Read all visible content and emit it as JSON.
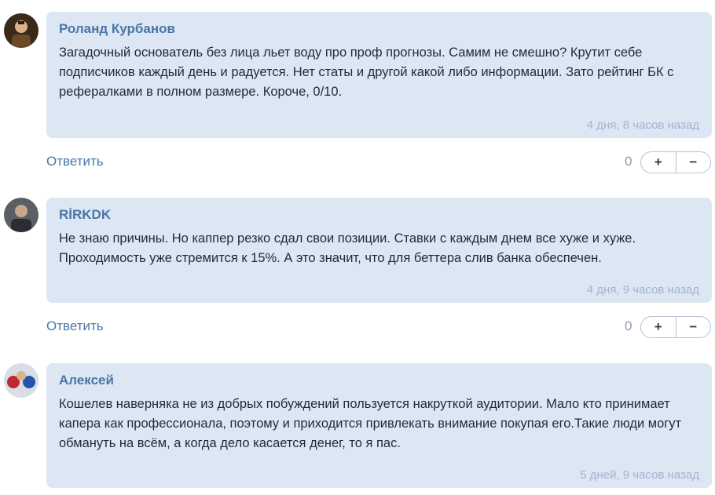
{
  "comments": [
    {
      "author": "Роланд Курбанов",
      "text": "Загадочный основатель без лица льет воду про проф прогнозы. Самим не смешно? Крутит себе подписчиков каждый день и радуется. Нет статы и другой какой либо информации. Зато рейтинг БК с рефералками в полном размере. Короче, 0/10.",
      "time": "4 дня, 8 часов назад",
      "reply_label": "Ответить",
      "score": "0",
      "plus": "+",
      "minus": "−"
    },
    {
      "author": "RİRKDK",
      "text": "Не знаю причины. Но каппер резко сдал свои позиции. Ставки с каждым днем все хуже и хуже. Проходимость уже стремится к 15%. А это значит, что для беттера слив банка обеспечен.",
      "time": "4 дня, 9 часов назад",
      "reply_label": "Ответить",
      "score": "0",
      "plus": "+",
      "minus": "−"
    },
    {
      "author": "Алексей",
      "text": "Кошелев наверняка не из добрых побуждений пользуется накруткой аудитории. Мало кто принимает капера как профессионала, поэтому и приходится привлекать внимание покупая его.Такие люди могут обмануть на всём, а когда дело касается денег, то я пас.",
      "time": "5 дней, 9 часов назад"
    }
  ]
}
